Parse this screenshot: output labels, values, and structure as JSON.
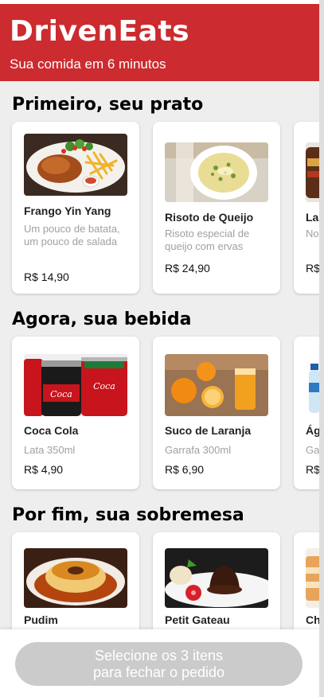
{
  "header": {
    "logo": "DrivenEats",
    "slogan": "Sua comida em 6 minutos"
  },
  "sections": [
    {
      "title": "Primeiro, seu prato",
      "items": [
        {
          "name": "Frango Yin Yang",
          "description": "Um pouco de batata, um pouco de salada",
          "price": "R$ 14,90",
          "image": "fried-chicken-fries-salad"
        },
        {
          "name": "Risoto de Queijo",
          "description": "Risoto especial de queijo com ervas",
          "price": "R$ 24,90",
          "image": "cheese-risotto"
        },
        {
          "name": "La",
          "description": "No las",
          "price": "R$",
          "image": "partial-dish"
        }
      ]
    },
    {
      "title": "Agora, sua bebida",
      "items": [
        {
          "name": "Coca Cola",
          "description": "Lata 350ml",
          "price": "R$ 4,90",
          "image": "coca-cola-cans"
        },
        {
          "name": "Suco de Laranja",
          "description": "Garrafa 300ml",
          "price": "R$ 6,90",
          "image": "orange-juice"
        },
        {
          "name": "Ág",
          "description": "Ga",
          "price": "R$",
          "image": "water-bottle"
        }
      ]
    },
    {
      "title": "Por fim, sua sobremesa",
      "items": [
        {
          "name": "Pudim",
          "description": "",
          "price": "",
          "image": "pudding"
        },
        {
          "name": "Petit Gateau",
          "description": "",
          "price": "",
          "image": "petit-gateau"
        },
        {
          "name": "Ch",
          "description": "",
          "price": "",
          "image": "partial-dessert"
        }
      ]
    }
  ],
  "footer": {
    "button_line1": "Selecione os 3 itens",
    "button_line2": "para fechar o pedido"
  },
  "colors": {
    "brand": "#cc2b2f",
    "button_disabled": "#cbcbcb"
  }
}
